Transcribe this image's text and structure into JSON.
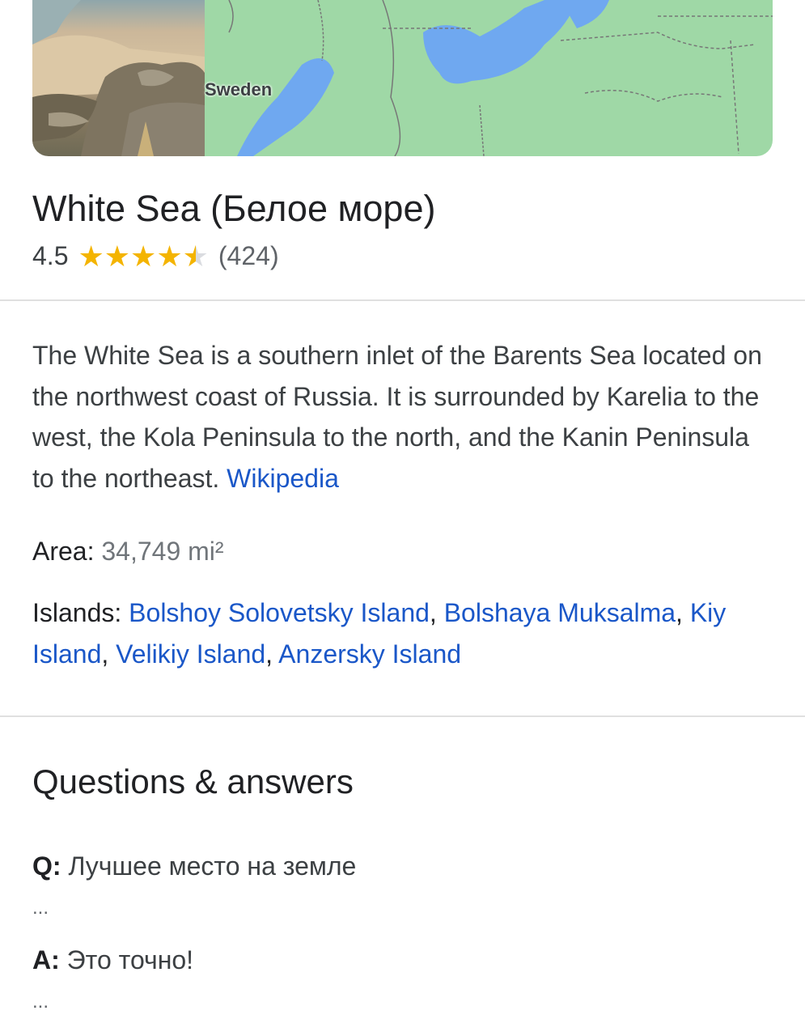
{
  "hero": {
    "map_label": "Sweden",
    "colors": {
      "water": "#6fa8f0",
      "land": "#9fd8a6"
    }
  },
  "place": {
    "title": "White Sea (Белое море)",
    "rating_value": "4.5",
    "rating_stars": 4.5,
    "review_count": "(424)"
  },
  "description": {
    "text": "The White Sea is a southern inlet of the Barents Sea located on the northwest coast of Russia. It is surrounded by Karelia to the west, the Kola Peninsula to the north, and the Kanin Peninsula to the northeast.",
    "source_link": "Wikipedia"
  },
  "facts": {
    "area_label": "Area:",
    "area_value": "34,749 mi²",
    "islands_label": "Islands:",
    "islands": [
      "Bolshoy Solovetsky Island",
      "Bolshaya Muksalma",
      "Kiy Island",
      "Velikiy Island",
      "Anzersky Island"
    ],
    "separator": ","
  },
  "qa": {
    "title": "Questions & answers",
    "q_prefix": "Q:",
    "question": "Лучшее место на земле",
    "q_more": "...",
    "a_prefix": "A:",
    "answer": "Это точно!",
    "a_more": "..."
  },
  "accent_colors": {
    "link": "#1a57c8",
    "star": "#f4b400"
  }
}
